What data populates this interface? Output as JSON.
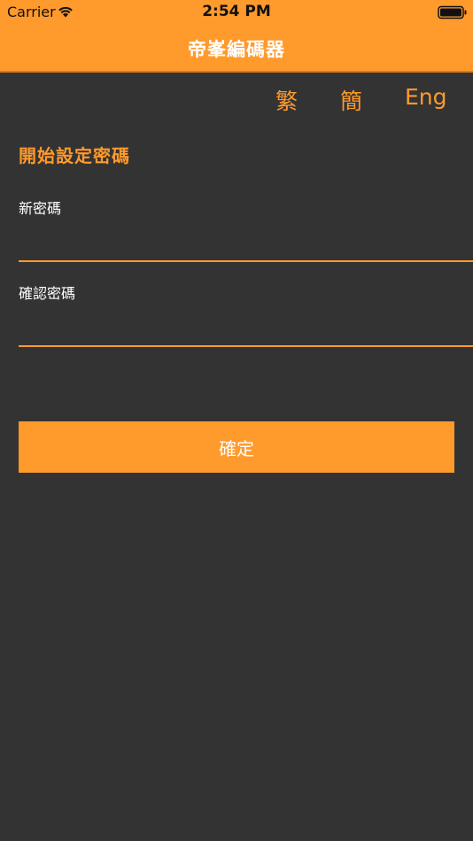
{
  "status_bar": {
    "carrier": "Carrier",
    "time": "2:54 PM",
    "wifi_icon": "wifi-icon",
    "battery_icon": "battery-icon"
  },
  "header": {
    "title": "帝峯編碼器"
  },
  "language_switch": {
    "traditional": "繁",
    "simplified": "簡",
    "english": "Eng"
  },
  "form": {
    "section_title": "開始設定密碼",
    "new_password_label": "新密碼",
    "new_password_value": "",
    "confirm_password_label": "確認密碼",
    "confirm_password_value": "",
    "confirm_button_label": "確定"
  },
  "colors": {
    "accent": "#FF9A2C",
    "background": "#333333",
    "text": "#FFFFFF"
  }
}
